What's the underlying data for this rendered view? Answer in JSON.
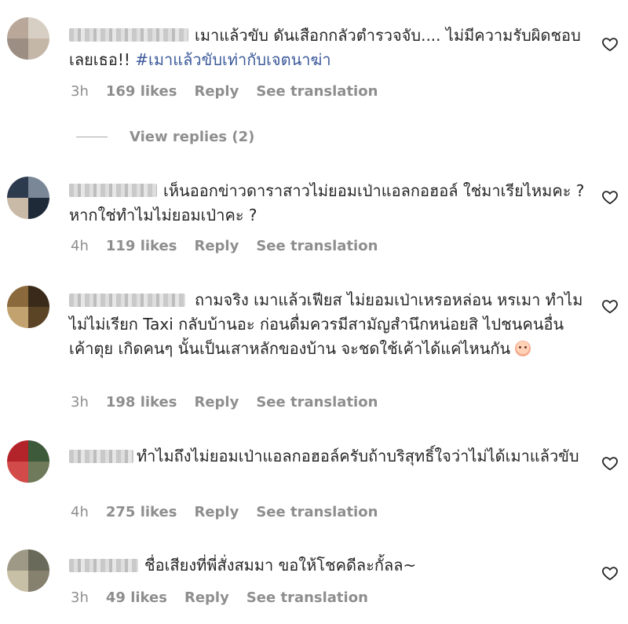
{
  "comments": [
    {
      "text_before": "เมาแล้วขับ ดันเสือกกลัวตำรวจจับ.... ไม่มีความรับผิดชอบเลยเธอ!! ",
      "hashtag": "#เมาแล้วขับเท่ากับเจตนาฆ่า",
      "time": "3h",
      "likes": "169 likes",
      "reply": "Reply",
      "translate": "See translation",
      "avatar_colors": [
        "#b9a89a",
        "#d8cfc4",
        "#9c8e82",
        "#c4b7a8"
      ]
    },
    {
      "text_before": "เห็นออกข่าวดาราสาวไม่ยอมเป่าแอลกอฮอล์ ใช่มาเรียไหมคะ ? หากใช่ทำไมไม่ยอมเป่าคะ ?",
      "time": "4h",
      "likes": "119 likes",
      "reply": "Reply",
      "translate": "See translation",
      "avatar_colors": [
        "#2d3b4e",
        "#7a8797",
        "#c9b9a7",
        "#1f2a38"
      ]
    },
    {
      "text_before": "ถามจริง เมาแล้วเฟียส ไม่ยอมเป่าเหรอหล่อน หรเมา ทำไมไม่ไม่เรียก Taxi กลับบ้านอะ ก่อนดื่มควรมีสามัญสำนึกหน่อยสิ ไปชนคนอื่นเค้าตุย เกิดคนๆ นั้นเป็นเสาหลักของบ้าน จะชดใช้เค้าได้แค่ไหนกัน",
      "emoji": "sad-face",
      "time": "3h",
      "likes": "198 likes",
      "reply": "Reply",
      "translate": "See translation",
      "avatar_colors": [
        "#8a6a3c",
        "#3a2a1a",
        "#c2a26e",
        "#5b4426"
      ]
    },
    {
      "text_before": "ทำไมถึงไม่ยอมเป่าแอลกอฮอล์ครับถ้าบริสุทธิ์ใจว่าไม่ได้เมาแล้วขับ",
      "time": "4h",
      "likes": "275 likes",
      "reply": "Reply",
      "translate": "See translation",
      "avatar_colors": [
        "#b3242a",
        "#3d5a3a",
        "#d24a4a",
        "#6e7a5a"
      ]
    },
    {
      "text_before": "ชื่อเสียงที่พี่สั่งสมมา ขอให้โชคดีละกั้ลล~",
      "time": "3h",
      "likes": "49 likes",
      "reply": "Reply",
      "translate": "See translation",
      "avatar_colors": [
        "#9e9886",
        "#6a6a5a",
        "#c7bfa6",
        "#86806e"
      ]
    }
  ],
  "view_replies": "View replies (2)",
  "colors": {
    "text": "#262626",
    "muted": "#8e8e8e",
    "hashtag": "#3c5a9a"
  },
  "icons": {
    "like": "heart-outline-icon"
  }
}
